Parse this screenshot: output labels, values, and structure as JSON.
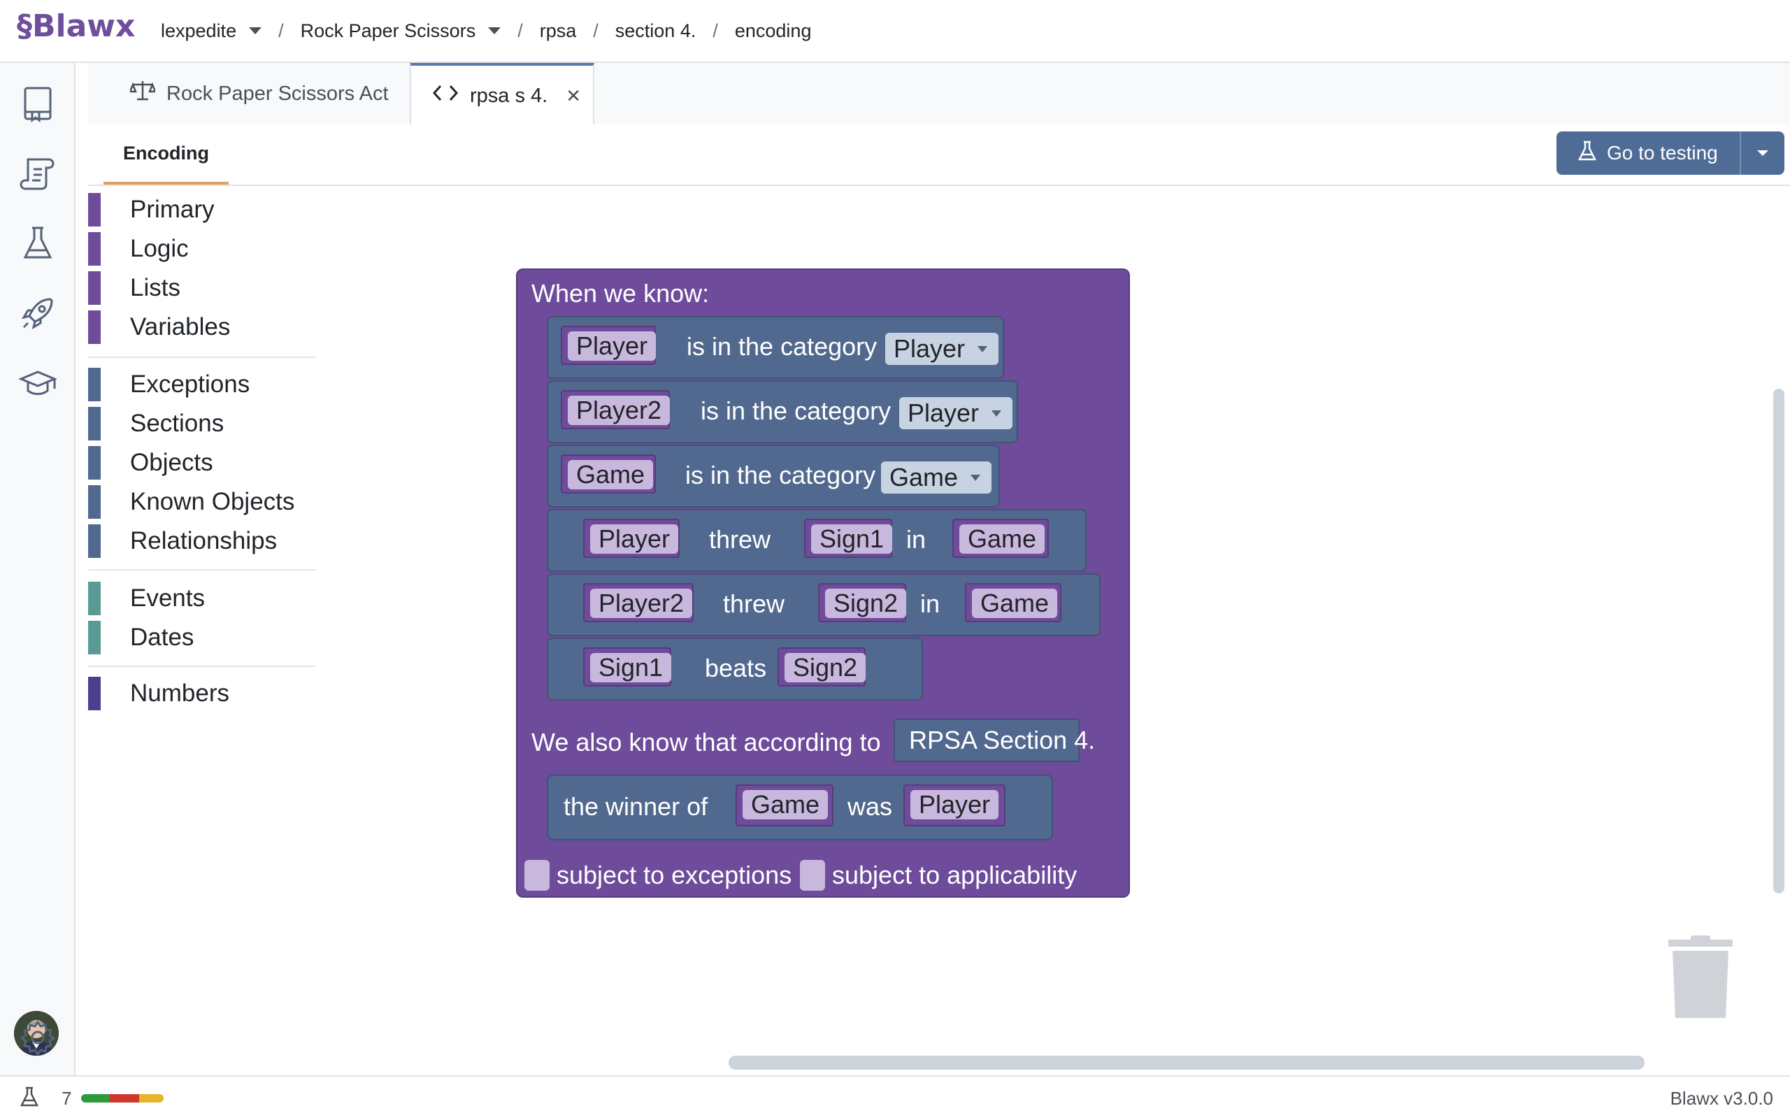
{
  "app": {
    "logo": "§Blawx",
    "version": "Blawx v3.0.0"
  },
  "breadcrumbs": [
    {
      "label": "lexpedite",
      "dropdown": true
    },
    {
      "label": "Rock Paper Scissors",
      "dropdown": true
    },
    {
      "label": "rpsa",
      "dropdown": false
    },
    {
      "label": "section 4.",
      "dropdown": false
    },
    {
      "label": "encoding",
      "dropdown": false
    }
  ],
  "rail": {
    "icons": [
      "book-icon",
      "scroll-icon",
      "flask-icon",
      "rocket-icon",
      "graduation-cap-icon",
      "settings-icon"
    ]
  },
  "tabs": {
    "act_label": "Rock Paper Scissors Act",
    "encoding_label": "rpsa s 4.",
    "close_glyph": "✕"
  },
  "subtabs": {
    "encoding_label": "Encoding",
    "go_testing_label": "Go to testing"
  },
  "toolbox": {
    "groups": [
      {
        "color": "#6e4c9b",
        "items": [
          "Primary",
          "Logic",
          "Lists",
          "Variables"
        ]
      },
      {
        "color": "#52698f",
        "items": [
          "Exceptions",
          "Sections",
          "Objects",
          "Known Objects",
          "Relationships"
        ]
      },
      {
        "color": "#5a9a94",
        "items": [
          "Events",
          "Dates"
        ]
      },
      {
        "color": "#4e3f8e",
        "items": [
          "Numbers"
        ]
      }
    ]
  },
  "rule": {
    "when_label": "When we know:",
    "conditions": {
      "c1": {
        "var": "Player",
        "text": "is in the category",
        "category": "Player"
      },
      "c2": {
        "var": "Player2",
        "text": "is in the category",
        "category": "Player"
      },
      "c3": {
        "var": "Game",
        "text": "is in the category",
        "category": "Game"
      },
      "c4": {
        "a": "Player",
        "verb": "threw",
        "b": "Sign1",
        "prep": "in",
        "c": "Game"
      },
      "c5": {
        "a": "Player2",
        "verb": "threw",
        "b": "Sign2",
        "prep": "in",
        "c": "Game"
      },
      "c6": {
        "a": "Sign1",
        "verb": "beats",
        "b": "Sign2"
      }
    },
    "also_label": "We also know that according to",
    "section_ref": "RPSA Section 4.",
    "conclusion": {
      "pre": "the winner of",
      "a": "Game",
      "mid": "was",
      "b": "Player"
    },
    "exceptions_label": "subject to exceptions",
    "applicability_label": "subject to applicability"
  },
  "status": {
    "count": "7",
    "progress_segments": [
      {
        "color": "#2e9a3e",
        "fraction": 0.35
      },
      {
        "color": "#6aa331",
        "fraction": 0.0
      },
      {
        "color": "#d0342c",
        "fraction": 0.15
      },
      {
        "color": "#cc3a2e",
        "fraction": 0.2
      },
      {
        "color": "#e8b22a",
        "fraction": 0.3
      }
    ]
  }
}
